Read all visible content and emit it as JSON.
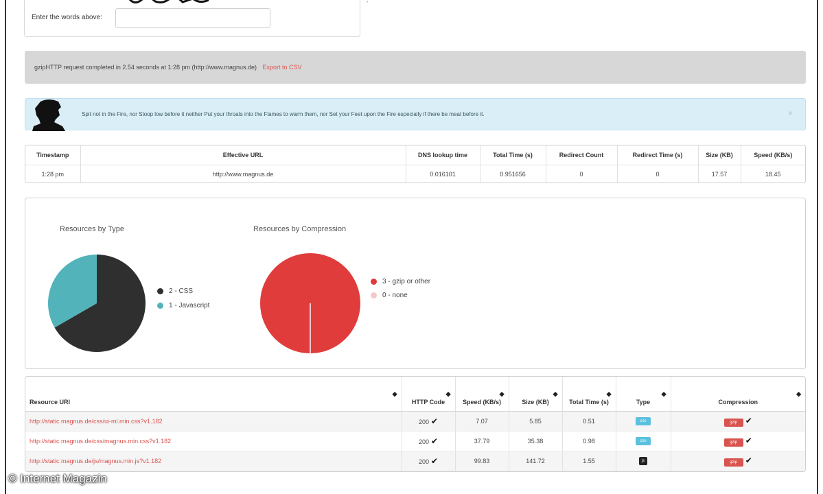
{
  "captcha": {
    "label": "Enter the words above:",
    "input_value": ""
  },
  "status": {
    "text": "gzipHTTP request completed in 2.54 seconds at 1:28 pm (http://www.magnus.de)",
    "export_link": "Export to CSV"
  },
  "alert": {
    "text": "Spit not in the Fire, nor Stoop low before it neither Put your throats into the Flames to warm them, nor Set your Feet upon the Fire especially if there be meat before it.",
    "close": "×"
  },
  "timing": {
    "headers": [
      "Timestamp",
      "Effective URL",
      "DNS lookup time",
      "Total Time (s)",
      "Redirect Count",
      "Redirect Time (s)",
      "Size (KB)",
      "Speed (KB/s)"
    ],
    "row": [
      "1:28 pm",
      "http://www.magnus.de",
      "0.016101",
      "0.951656",
      "0",
      "0",
      "17.57",
      "18.45"
    ]
  },
  "charts": {
    "type_chart": {
      "title": "Resources by Type",
      "legend": [
        "2 - CSS",
        "1 - Javascript"
      ]
    },
    "compression_chart": {
      "title": "Resources by Compression",
      "legend": [
        "3 - gzip or other",
        "0 - none"
      ]
    }
  },
  "chart_data": [
    {
      "type": "pie",
      "title": "Resources by Type",
      "categories": [
        "CSS",
        "Javascript"
      ],
      "values": [
        2,
        1
      ],
      "colors": [
        "#2f2f2f",
        "#52b3ba"
      ]
    },
    {
      "type": "pie",
      "title": "Resources by Compression",
      "categories": [
        "gzip or other",
        "none"
      ],
      "values": [
        3,
        0
      ],
      "colors": [
        "#e03c3c",
        "#f3c9c9"
      ]
    }
  ],
  "resources": {
    "headers": {
      "uri": "Resource URI",
      "http_code": "HTTP Code",
      "speed": "Speed (KB/s)",
      "size": "Size (KB)",
      "total_time": "Total Time (s)",
      "type": "Type",
      "compression": "Compression"
    },
    "rows": [
      {
        "uri": "http://static.magnus.de/css/ui-ml.min.css?v1.182",
        "code": "200",
        "speed": "7.07",
        "size": "5.85",
        "time": "0.51",
        "type": "css",
        "compression": "gzip"
      },
      {
        "uri": "http://static.magnus.de/css/magnus.min.css?v1.182",
        "code": "200",
        "speed": "37.79",
        "size": "35.38",
        "time": "0.98",
        "type": "css",
        "compression": "gzip"
      },
      {
        "uri": "http://static.magnus.de/js/magnus.min.js?v1.182",
        "code": "200",
        "speed": "99.83",
        "size": "141.72",
        "time": "1.55",
        "type": "js",
        "compression": "gzip"
      }
    ]
  },
  "watermark": "© Internet Magazin"
}
